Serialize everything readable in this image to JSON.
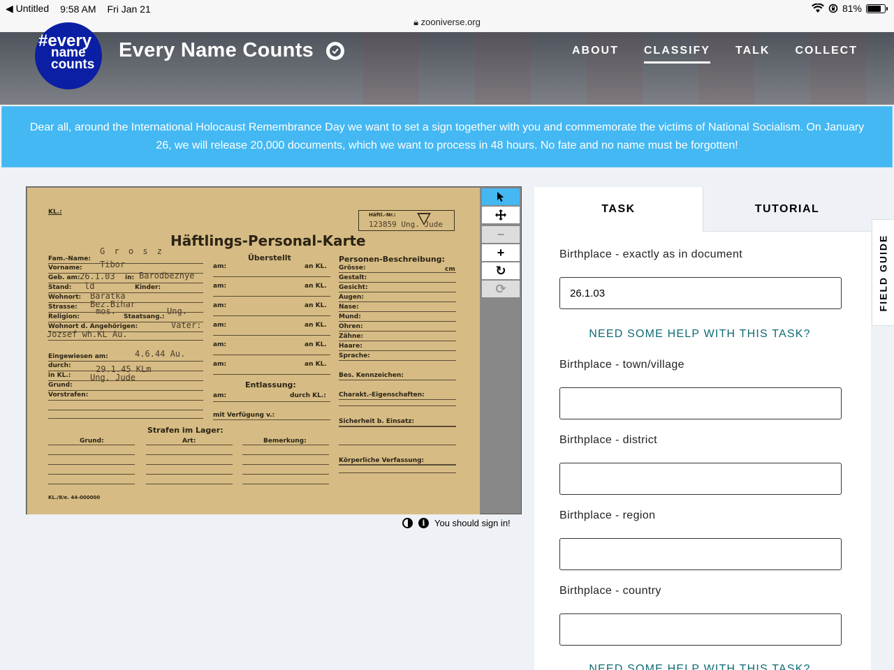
{
  "status_bar": {
    "back_app": "Untitled",
    "time": "9:58 AM",
    "date": "Fri Jan 21",
    "url": "zooniverse.org",
    "battery": "81%",
    "battery_level": 0.81
  },
  "project": {
    "avatar_line1": "#every",
    "avatar_line2": "name",
    "avatar_line3": "counts",
    "title": "Every Name Counts",
    "nav": [
      "ABOUT",
      "CLASSIFY",
      "TALK",
      "COLLECT"
    ],
    "active_nav": "CLASSIFY"
  },
  "announcement": "Dear all, around the International Holocaust Remembrance Day we want to set a sign together with you and commemorate the victims of National Socialism. On January 26, we will release 20,000 documents, which we want to process in 48 hours. No fate and no name must be forgotten!",
  "card": {
    "kl": "KL.:",
    "heading": "Häftlings-Personal-Karte",
    "number_label": "Häftl.-Nr.:",
    "number_value": "123859 Ung. Jude",
    "sections": {
      "ueberstellt": "Überstellt",
      "beschreibung": "Personen-Beschreibung:",
      "entlassung": "Entlassung:",
      "strafen": "Strafen im Lager:"
    },
    "left_labels": [
      "Fam.-Name:",
      "Vorname:",
      "Geb. am:",
      "Stand:",
      "Wohnort:",
      "Strasse:",
      "Religion:",
      "Wohnort d. Angehörigen:",
      "Eingewiesen am:",
      "durch:",
      "in KL.:",
      "Grund:",
      "Vorstrafen:"
    ],
    "mid_labels": {
      "am": "am:",
      "an_kl": "an KL.",
      "durch_kl": "durch KL.:",
      "mit_verfuegung": "mit Verfügung v.:",
      "kinder": "Kinder:",
      "staatsang": "Staatsang.:",
      "in": "in:"
    },
    "right_labels": [
      "Grösse:",
      "Gestalt:",
      "Gesicht:",
      "Augen:",
      "Nase:",
      "Mund:",
      "Ohren:",
      "Zähne:",
      "Haare:",
      "Sprache:",
      "Bes. Kennzeichen:",
      "Charakt.-Eigenschaften:",
      "Sicherheit b. Einsatz:",
      "Körperliche Verfassung:"
    ],
    "cm": "cm",
    "bottom_cols": [
      "Grund:",
      "Art:",
      "Bemerkung:"
    ],
    "footer_code": "KL./8/e. 44-000000",
    "handwriting": {
      "fam_name": "G r o s z",
      "vorname": "Tibor",
      "geb_am": "26.1.03",
      "geb_in": "Barodbeznye",
      "stand": "ld",
      "wohnort": "Baratka",
      "strasse": "Bez.Bihar",
      "religion": "mos.",
      "staatsang": "Ung.",
      "angehoerige_1": "Vater:",
      "angehoerige_2": "Jozsef wh.KL Au.",
      "eingewiesen": "4.6.44 Au.",
      "durch": "29.1.45 KLm",
      "in_kl": "Ung. Jude"
    }
  },
  "viewer_footer": {
    "sign_in": "You should sign in!"
  },
  "task_panel": {
    "tabs": [
      "TASK",
      "TUTORIAL"
    ],
    "fields": [
      {
        "label": "Birthplace - exactly as in document",
        "value": "26.1.03",
        "placeholder": ""
      },
      {
        "label": "Birthplace - town/village",
        "value": "",
        "placeholder": ""
      },
      {
        "label": "Birthplace - district",
        "value": "",
        "placeholder": ""
      },
      {
        "label": "Birthplace - region",
        "value": "",
        "placeholder": ""
      },
      {
        "label": "Birthplace - country",
        "value": "",
        "placeholder": ""
      }
    ],
    "help_link": "NEED SOME HELP WITH THIS TASK?",
    "help_link_2": "NEED SOME HELP WITH THIS TASK?"
  },
  "field_guide": "FIELD GUIDE",
  "colors": {
    "accent": "#43b8f3",
    "avatar": "#0a1fa3",
    "help_link": "#0f6b75",
    "card": "#d6bc84"
  },
  "icons": [
    "back-arrow-icon",
    "wifi-icon",
    "lock-rotation-icon",
    "battery-icon",
    "lock-icon",
    "verified-check-icon",
    "pointer-icon",
    "move-icon",
    "zoom-out-icon",
    "zoom-in-icon",
    "rotate-icon",
    "reset-icon",
    "invert-icon",
    "info-icon"
  ]
}
